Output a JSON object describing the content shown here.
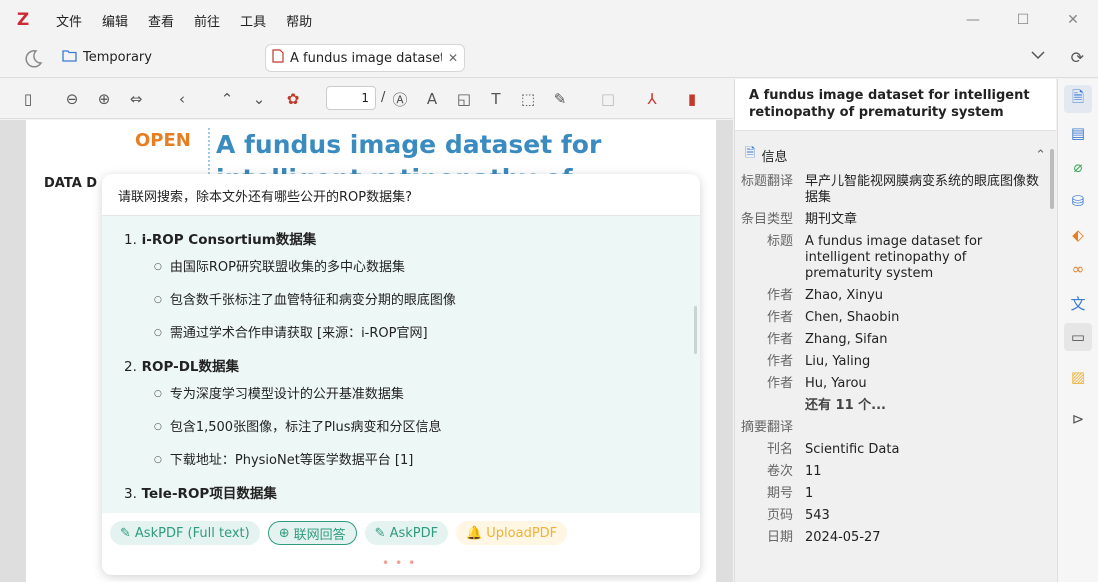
{
  "menu": {
    "items": [
      "文件",
      "编辑",
      "查看",
      "前往",
      "工具",
      "帮助"
    ]
  },
  "tabs": {
    "library": "Temporary",
    "document": "A fundus image dataset"
  },
  "toolbar": {
    "page_value": "1",
    "page_sep": "/"
  },
  "pdf": {
    "open_label": "OPEN",
    "title": "A fundus image dataset for intelligent retinopathy of",
    "side_label": "DATA D"
  },
  "chat": {
    "question": "请联网搜索，除本文外还有哪些公开的ROP数据集?",
    "answer": [
      {
        "num": "1.",
        "title": "i-ROP Consortium数据集",
        "bullets": [
          "由国际ROP研究联盟收集的多中心数据集",
          "包含数千张标注了血管特征和病变分期的眼底图像",
          "需通过学术合作申请获取 [来源：i-ROP官网]"
        ]
      },
      {
        "num": "2.",
        "title": "ROP-DL数据集",
        "bullets": [
          "专为深度学习模型设计的公开基准数据集",
          "包含1,500张图像，标注了Plus病变和分区信息",
          "下载地址：PhysioNet等医学数据平台 [1]"
        ]
      },
      {
        "num": "3.",
        "title": "Tele-ROP项目数据集",
        "bullets": []
      }
    ],
    "actions": {
      "askfull": "AskPDF (Full text)",
      "web": "联网回答",
      "ask": "AskPDF",
      "upload": "UploadPDF"
    },
    "dots": "•••"
  },
  "item_pane": {
    "title": "A fundus image dataset for intelligent retinopathy of prematurity system",
    "section": "信息",
    "fields": [
      {
        "k": "标题翻译",
        "v": "早产儿智能视网膜病变系统的眼底图像数据集"
      },
      {
        "k": "条目类型",
        "v": "期刊文章"
      },
      {
        "k": "标题",
        "v": "A fundus image dataset for intelligent retinopathy of prematurity system"
      },
      {
        "k": "作者",
        "v": "Zhao, Xinyu"
      },
      {
        "k": "作者",
        "v": "Chen, Shaobin"
      },
      {
        "k": "作者",
        "v": "Zhang, Sifan"
      },
      {
        "k": "作者",
        "v": "Liu, Yaling"
      },
      {
        "k": "作者",
        "v": "Hu, Yarou"
      }
    ],
    "more": "还有 11 个...",
    "fields2": [
      {
        "k": "摘要翻译",
        "v": ""
      },
      {
        "k": "刊名",
        "v": "Scientific Data"
      },
      {
        "k": "卷次",
        "v": "11"
      },
      {
        "k": "期号",
        "v": "1"
      },
      {
        "k": "页码",
        "v": "543"
      },
      {
        "k": "日期",
        "v": "2024-05-27"
      }
    ]
  },
  "colors": {
    "zotero_red": "#cc2936",
    "open_orange": "#e67e22",
    "title_blue": "#3a8bbf",
    "chat_green": "#2e9b7e",
    "upload_yellow": "#f0b236"
  }
}
